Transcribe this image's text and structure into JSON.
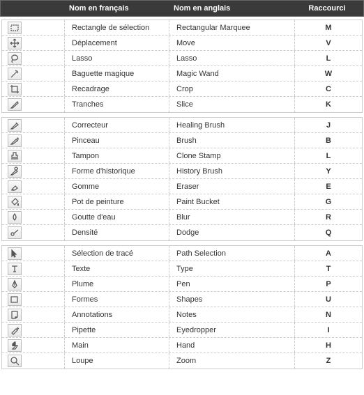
{
  "headers": {
    "fr": "Nom en français",
    "en": "Nom en anglais",
    "sc": "Raccourci"
  },
  "groups": [
    {
      "tools": [
        {
          "icon": "marquee-icon",
          "fr": "Rectangle de sélection",
          "en": "Rectangular Marquee",
          "sc": "M"
        },
        {
          "icon": "move-icon",
          "fr": "Déplacement",
          "en": "Move",
          "sc": "V"
        },
        {
          "icon": "lasso-icon",
          "fr": "Lasso",
          "en": "Lasso",
          "sc": "L"
        },
        {
          "icon": "wand-icon",
          "fr": "Baguette magique",
          "en": "Magic Wand",
          "sc": "W"
        },
        {
          "icon": "crop-icon",
          "fr": "Recadrage",
          "en": "Crop",
          "sc": "C"
        },
        {
          "icon": "slice-icon",
          "fr": "Tranches",
          "en": "Slice",
          "sc": "K"
        }
      ]
    },
    {
      "tools": [
        {
          "icon": "healing-icon",
          "fr": "Correcteur",
          "en": "Healing Brush",
          "sc": "J"
        },
        {
          "icon": "brush-icon",
          "fr": "Pinceau",
          "en": "Brush",
          "sc": "B"
        },
        {
          "icon": "stamp-icon",
          "fr": "Tampon",
          "en": "Clone Stamp",
          "sc": "L"
        },
        {
          "icon": "history-brush-icon",
          "fr": "Forme d'historique",
          "en": "History Brush",
          "sc": "Y"
        },
        {
          "icon": "eraser-icon",
          "fr": "Gomme",
          "en": "Eraser",
          "sc": "E"
        },
        {
          "icon": "bucket-icon",
          "fr": "Pot de peinture",
          "en": "Paint Bucket",
          "sc": "G"
        },
        {
          "icon": "blur-icon",
          "fr": "Goutte d'eau",
          "en": "Blur",
          "sc": "R"
        },
        {
          "icon": "dodge-icon",
          "fr": "Densité",
          "en": "Dodge",
          "sc": "Q"
        }
      ]
    },
    {
      "tools": [
        {
          "icon": "path-select-icon",
          "fr": "Sélection de tracé",
          "en": "Path Selection",
          "sc": "A"
        },
        {
          "icon": "type-icon",
          "fr": "Texte",
          "en": "Type",
          "sc": "T"
        },
        {
          "icon": "pen-icon",
          "fr": "Plume",
          "en": "Pen",
          "sc": "P"
        },
        {
          "icon": "shapes-icon",
          "fr": "Formes",
          "en": "Shapes",
          "sc": "U"
        },
        {
          "icon": "notes-icon",
          "fr": " Annotations",
          "en": "Notes",
          "sc": "N"
        },
        {
          "icon": "eyedropper-icon",
          "fr": "Pipette",
          "en": "Eyedropper",
          "sc": "I"
        },
        {
          "icon": "hand-icon",
          "fr": "Main",
          "en": "Hand",
          "sc": "H"
        },
        {
          "icon": "zoom-icon",
          "fr": "Loupe",
          "en": "Zoom",
          "sc": "Z"
        }
      ]
    }
  ]
}
